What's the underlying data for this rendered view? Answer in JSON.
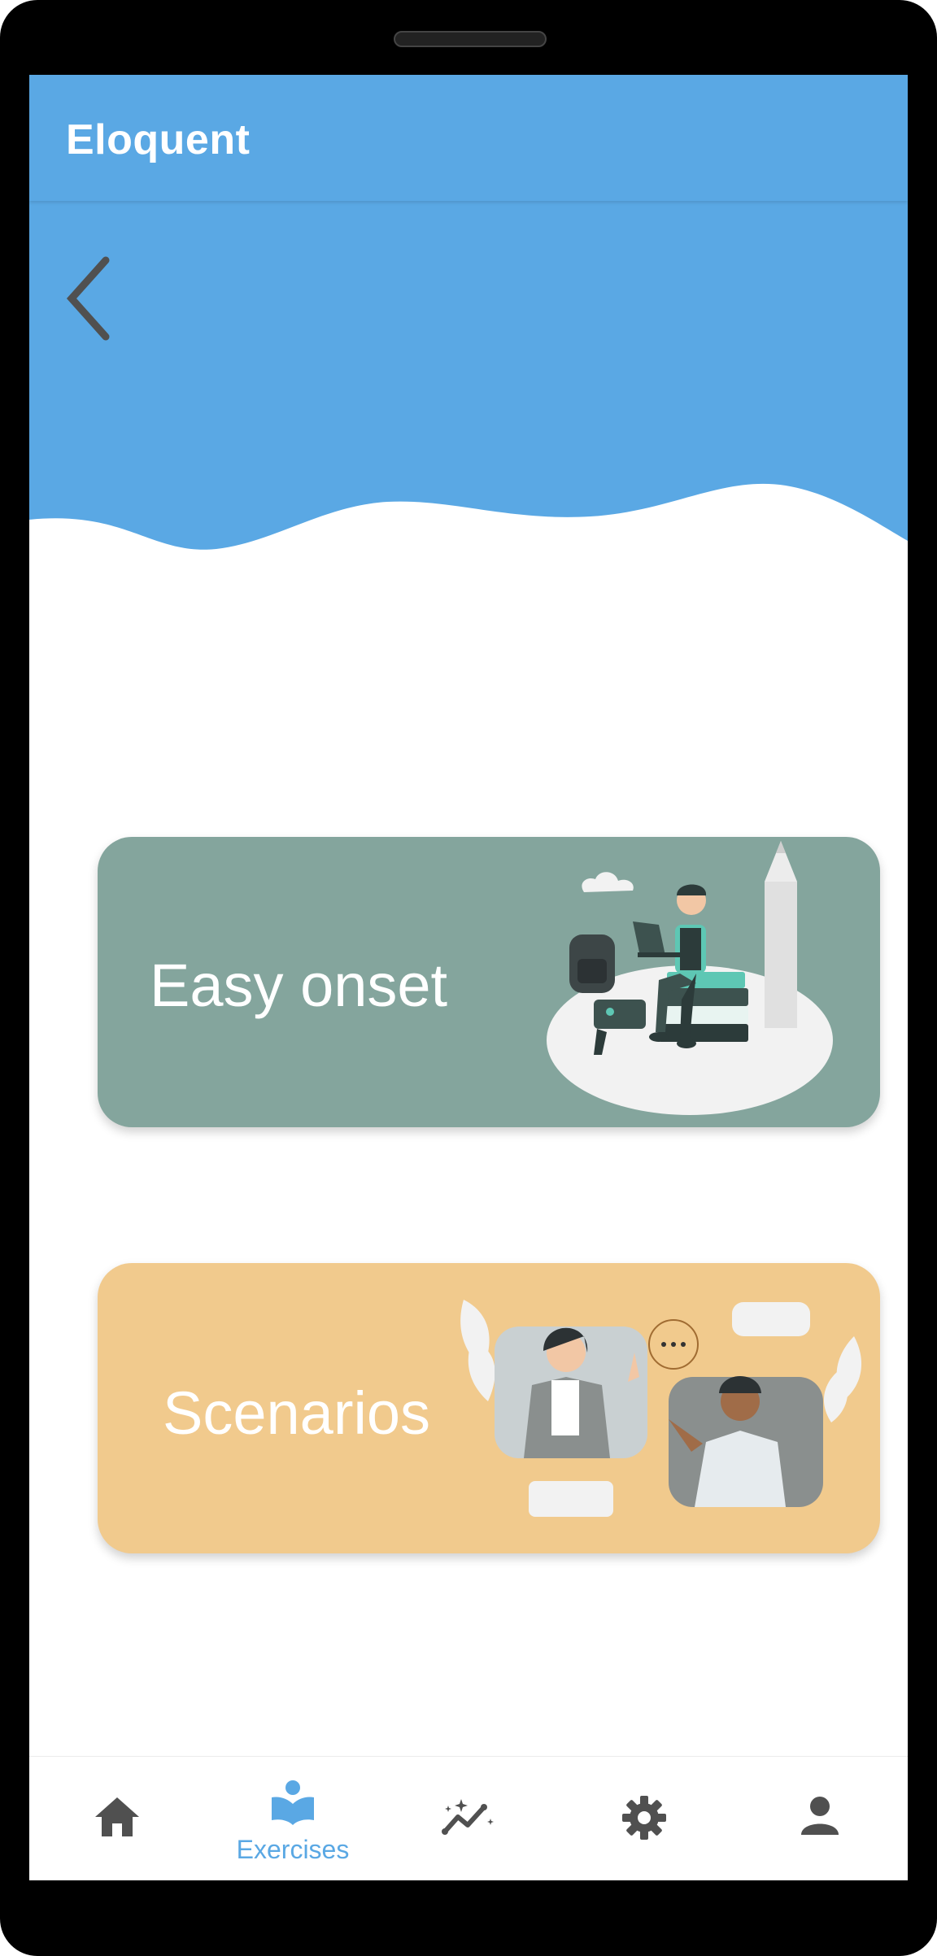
{
  "app": {
    "title": "Eloquent"
  },
  "cards": [
    {
      "label": "Easy onset",
      "color": "#84a59d"
    },
    {
      "label": "Scenarios",
      "color": "#f1ca8d"
    }
  ],
  "nav": {
    "active": "exercises",
    "items": [
      {
        "icon": "home-icon",
        "label": ""
      },
      {
        "icon": "exercises-book-icon",
        "label": "Exercises"
      },
      {
        "icon": "progress-chart-icon",
        "label": ""
      },
      {
        "icon": "settings-gear-icon",
        "label": ""
      },
      {
        "icon": "profile-person-icon",
        "label": ""
      }
    ]
  },
  "colors": {
    "primary": "#5aa8e4",
    "icon_gray": "#505050"
  }
}
